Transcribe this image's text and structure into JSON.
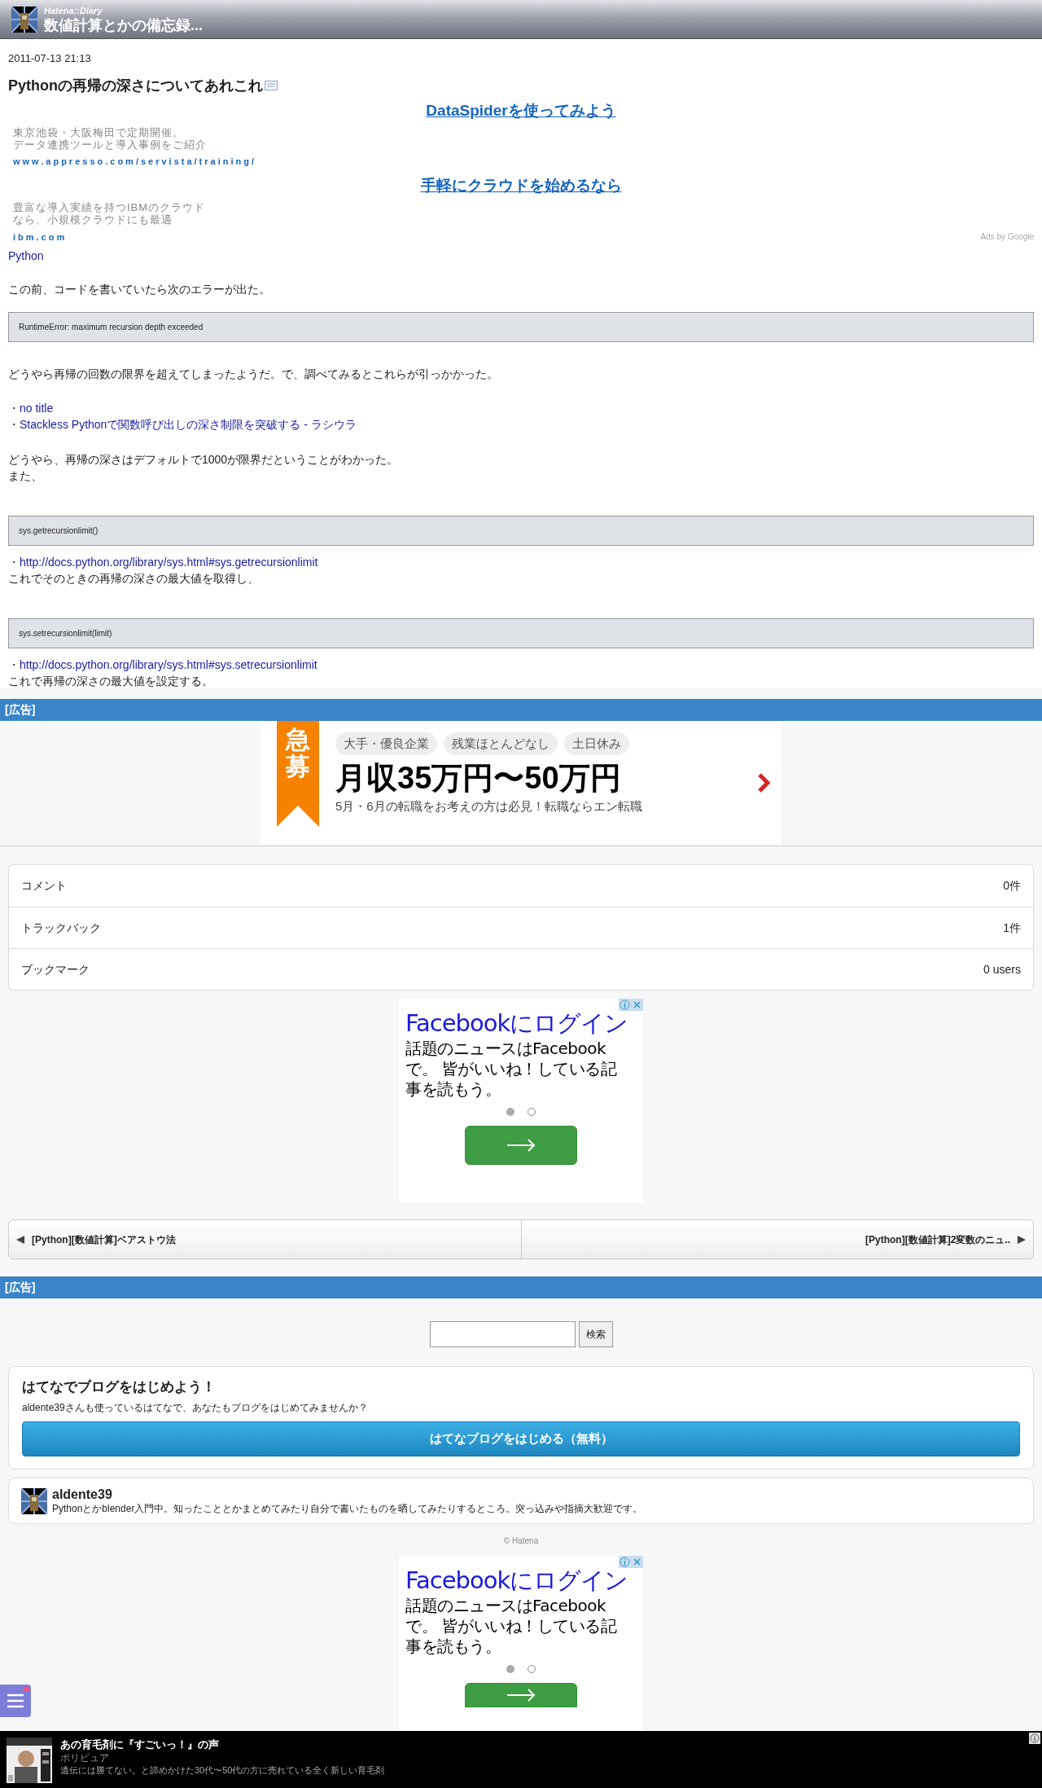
{
  "header": {
    "site": "Hatena::Diary",
    "title": "数値計算とかの備忘録..."
  },
  "entry": {
    "date": "2011-07-13 21:13",
    "title": "Pythonの再帰の深さについてあれこれ",
    "ads": [
      {
        "title": "DataSpiderを使ってみよう",
        "lines": [
          "東京池袋・大阪梅田で定期開催。",
          "データ連携ツールと導入事例をご紹介"
        ],
        "url": "www.appresso.com/servista/training/"
      },
      {
        "title": "手軽にクラウドを始めるなら",
        "lines": [
          "豊富な導入実績を持つIBMのクラウド",
          "なら、小規模クラウドにも最適"
        ],
        "url": "ibm.com"
      }
    ],
    "ads_label": "Ads by Google",
    "category": "Python",
    "blocks": [
      {
        "kind": "para",
        "lines": [
          [
            {
              "kind": "text",
              "text": "この前、コードを書いていたら次のエラーが出た。"
            }
          ]
        ]
      },
      {
        "kind": "code",
        "text": "RuntimeError: maximum recursion depth exceeded"
      },
      {
        "kind": "para",
        "lines": [
          [
            {
              "kind": "text",
              "text": "どうやら再帰の回数の限界を超えてしまったようだ。で、調べてみるとこれらが引っかかった。"
            }
          ]
        ]
      },
      {
        "kind": "para",
        "lines": [
          [
            {
              "kind": "text",
              "text": "・"
            },
            {
              "kind": "link",
              "text": "no title"
            }
          ],
          [
            {
              "kind": "text",
              "text": "・"
            },
            {
              "kind": "link",
              "text": "Stackless Pythonで関数呼び出しの深さ制限を突破する - ラシウラ"
            }
          ]
        ]
      },
      {
        "kind": "para",
        "lines": [
          [
            {
              "kind": "text",
              "text": "どうやら、再帰の深さはデフォルトで1000が限界だということがわかった。"
            }
          ],
          [
            {
              "kind": "text",
              "text": "また、"
            }
          ]
        ]
      },
      {
        "kind": "code",
        "text": "sys.getrecursionlimit()"
      },
      {
        "kind": "para",
        "lines": [
          [
            {
              "kind": "text",
              "text": "・"
            },
            {
              "kind": "link",
              "text": "http://docs.python.org/library/sys.html#sys.getrecursionlimit"
            }
          ],
          [
            {
              "kind": "text",
              "text": "これでそのときの再帰の深さの最大値を取得し、"
            }
          ]
        ]
      },
      {
        "kind": "code",
        "text": "sys.setrecursionlimit(limit)"
      },
      {
        "kind": "para",
        "lines": [
          [
            {
              "kind": "text",
              "text": "・"
            },
            {
              "kind": "link",
              "text": "http://docs.python.org/library/sys.html#sys.setrecursionlimit"
            }
          ],
          [
            {
              "kind": "text",
              "text": "これで再帰の深さの最大値を設定する。"
            }
          ]
        ]
      }
    ]
  },
  "ad_label_1": "[広告]",
  "banner": {
    "badge": "急募",
    "tags": [
      "大手・優良企業",
      "残業ほとんどなし",
      "土日休み"
    ],
    "headline": "月収35万円〜50万円",
    "sub": "5月・6月の転職をお考えの方は必見！転職ならエン転職"
  },
  "stats": [
    {
      "label": "コメント",
      "value": "0件"
    },
    {
      "label": "トラックバック",
      "value": "1件"
    },
    {
      "label": "ブックマーク",
      "value": "0 users"
    }
  ],
  "fb_ads": [
    {
      "title": "Facebookにログイン",
      "body": "話題のニュースはFacebookで。 皆がいいね！している記事を読もう。",
      "dots": [
        {
          "selected": true
        },
        {
          "selected": false
        }
      ]
    },
    {
      "title": "Facebookにログイン",
      "body": "話題のニュースはFacebookで。 皆がいいね！している記事を読もう。",
      "dots": [
        {
          "selected": true
        },
        {
          "selected": false
        }
      ]
    }
  ],
  "nav": {
    "prev": "[Python][数値計算]ベアストウ法",
    "next": "[Python][数値計算]2変数のニュ.."
  },
  "ad_label_2": "[広告]",
  "search": {
    "button": "検索"
  },
  "signup": {
    "title": "はてなでブログをはじめよう！",
    "text": "aldente39さんも使っているはてなで、あなたもブログをはじめてみませんか？",
    "button": "はてなブログをはじめる（無料）"
  },
  "profile": {
    "name": "aldente39",
    "bio": "Pythonとかblender入門中。知ったこととかまとめてみたり自分で書いたものを晒してみたりするところ。突っ込みや指摘大歓迎です。"
  },
  "footer": "© Hatena",
  "bottom_ad": {
    "title": "あの育毛剤に『すごいっ！』の声",
    "source": "ポリピュア",
    "text": "遺伝には勝てない。と諦めかけた30代〜50代の方に売れている全く新しい育毛剤"
  }
}
